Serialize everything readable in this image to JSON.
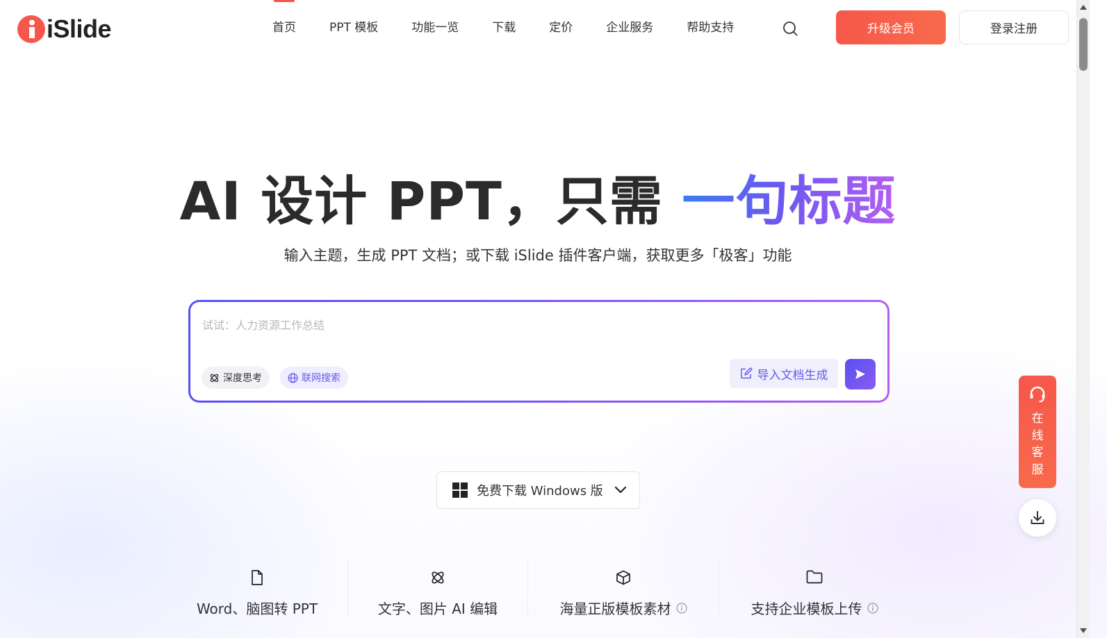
{
  "brand": {
    "name": "iSlide",
    "logo_icon": "islide-logo-icon",
    "primary_color": "#f6574a",
    "accent_color": "#6a58f0"
  },
  "nav": {
    "items": [
      {
        "label": "首页",
        "active": true
      },
      {
        "label": "PPT 模板"
      },
      {
        "label": "功能一览"
      },
      {
        "label": "下载"
      },
      {
        "label": "定价"
      },
      {
        "label": "企业服务"
      },
      {
        "label": "帮助支持"
      }
    ],
    "search_icon": "search-icon",
    "upgrade_label": "升级会员",
    "login_label": "登录注册"
  },
  "hero": {
    "title_main": "AI 设计 PPT，只需 ",
    "title_highlight": "一句标题",
    "subtitle": "输入主题，生成 PPT 文档；或下载 iSlide 插件客户端，获取更多「极客」功能"
  },
  "prompt": {
    "placeholder": "试试：人力资源工作总结",
    "value": "",
    "chip_deep_think": "深度思考",
    "chip_web_search": "联网搜索",
    "import_label": "导入文档生成",
    "send_icon": "send-icon"
  },
  "download": {
    "label": "免费下载 Windows 版",
    "icon": "windows-icon"
  },
  "features": [
    {
      "label": "Word、脑图转 PPT",
      "icon": "document-icon",
      "info": false
    },
    {
      "label": "文字、图片 AI 编辑",
      "icon": "ai-atom-icon",
      "info": false
    },
    {
      "label": "海量正版模板素材",
      "icon": "cube-icon",
      "info": true
    },
    {
      "label": "支持企业模板上传",
      "icon": "folder-icon",
      "info": true
    }
  ],
  "side": {
    "customer_service": "在线客服",
    "download_icon": "download-icon"
  }
}
